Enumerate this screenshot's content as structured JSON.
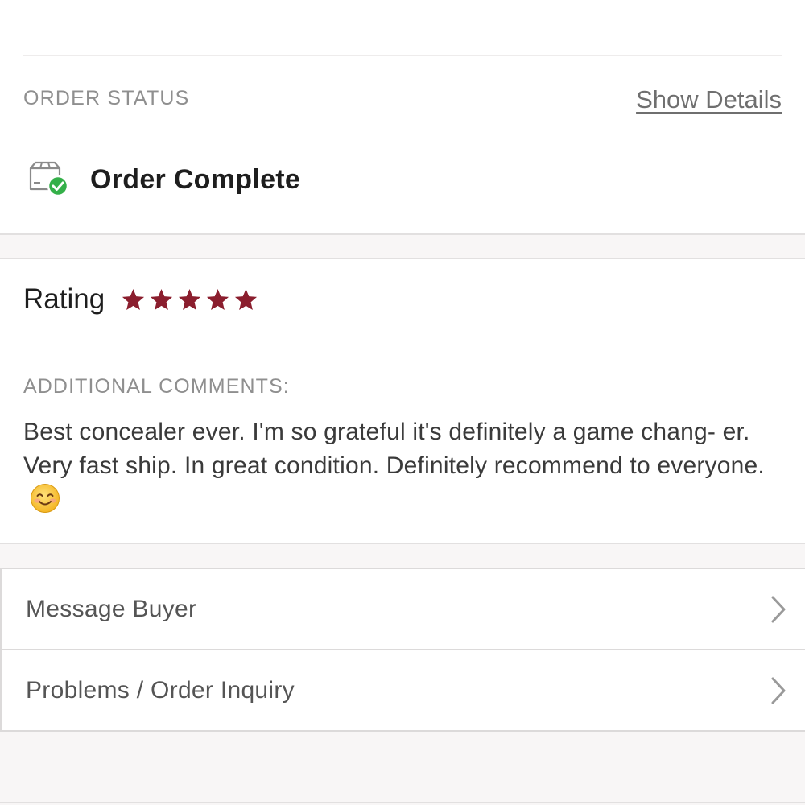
{
  "order_status": {
    "section_label": "ORDER STATUS",
    "show_details_label": "Show Details",
    "status_text": "Order Complete",
    "status_icon": "package-check-icon",
    "status_icon_color": "#34b049"
  },
  "rating": {
    "label": "Rating",
    "stars": 5,
    "max_stars": 5,
    "star_color": "#8b1e2e"
  },
  "comments": {
    "label": "ADDITIONAL COMMENTS:",
    "text": "Best concealer ever. I'm so grateful it's definitely a game chang- er. Very fast ship. In great condition. Definitely recommend to everyone.",
    "emoji": "smiling-face-icon"
  },
  "actions": [
    {
      "label": "Message Buyer",
      "icon": "chevron-right-icon"
    },
    {
      "label": "Problems / Order Inquiry",
      "icon": "chevron-right-icon"
    }
  ]
}
